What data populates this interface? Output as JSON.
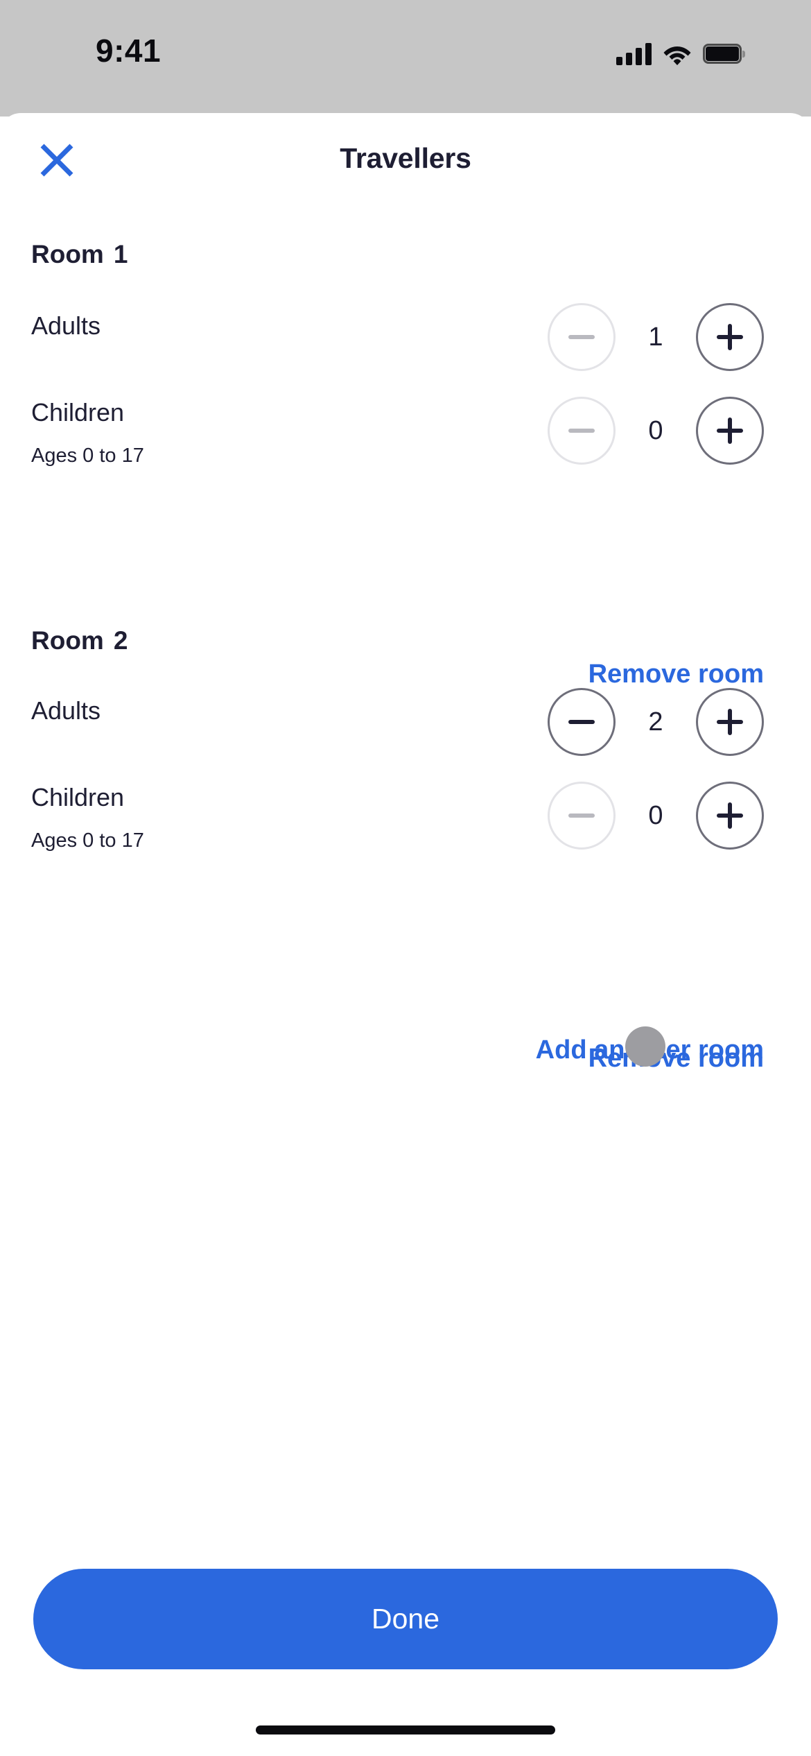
{
  "status_bar": {
    "time": "9:41",
    "cellular_icon": "cellular-bars-icon",
    "wifi_icon": "wifi-icon",
    "battery_icon": "battery-full-icon"
  },
  "theme": {
    "accent_blue": "#2b68de",
    "text_navy": "#1e1e33",
    "disabled_gray": "#e3e3e7",
    "enabled_border": "#6e6e7a",
    "status_bar_bg": "#c6c6c6",
    "touch_indicator": "#9d9da1"
  },
  "header": {
    "title": "Travellers",
    "close_icon": "close-x-icon"
  },
  "rooms": [
    {
      "heading_label": "Room",
      "heading_number": "1",
      "rows": [
        {
          "label": "Adults",
          "sublabel": "",
          "value": "1",
          "decrement_enabled": false,
          "increment_enabled": true
        },
        {
          "label": "Children",
          "sublabel": "Ages 0 to 17",
          "value": "0",
          "decrement_enabled": false,
          "increment_enabled": true
        }
      ],
      "remove_label": "Remove room"
    },
    {
      "heading_label": "Room",
      "heading_number": "2",
      "rows": [
        {
          "label": "Adults",
          "sublabel": "",
          "value": "2",
          "decrement_enabled": true,
          "increment_enabled": true
        },
        {
          "label": "Children",
          "sublabel": "Ages 0 to 17",
          "value": "0",
          "decrement_enabled": false,
          "increment_enabled": true
        }
      ],
      "remove_label": "Remove room"
    }
  ],
  "add_room_label": "Add another room",
  "footer": {
    "done_label": "Done"
  }
}
